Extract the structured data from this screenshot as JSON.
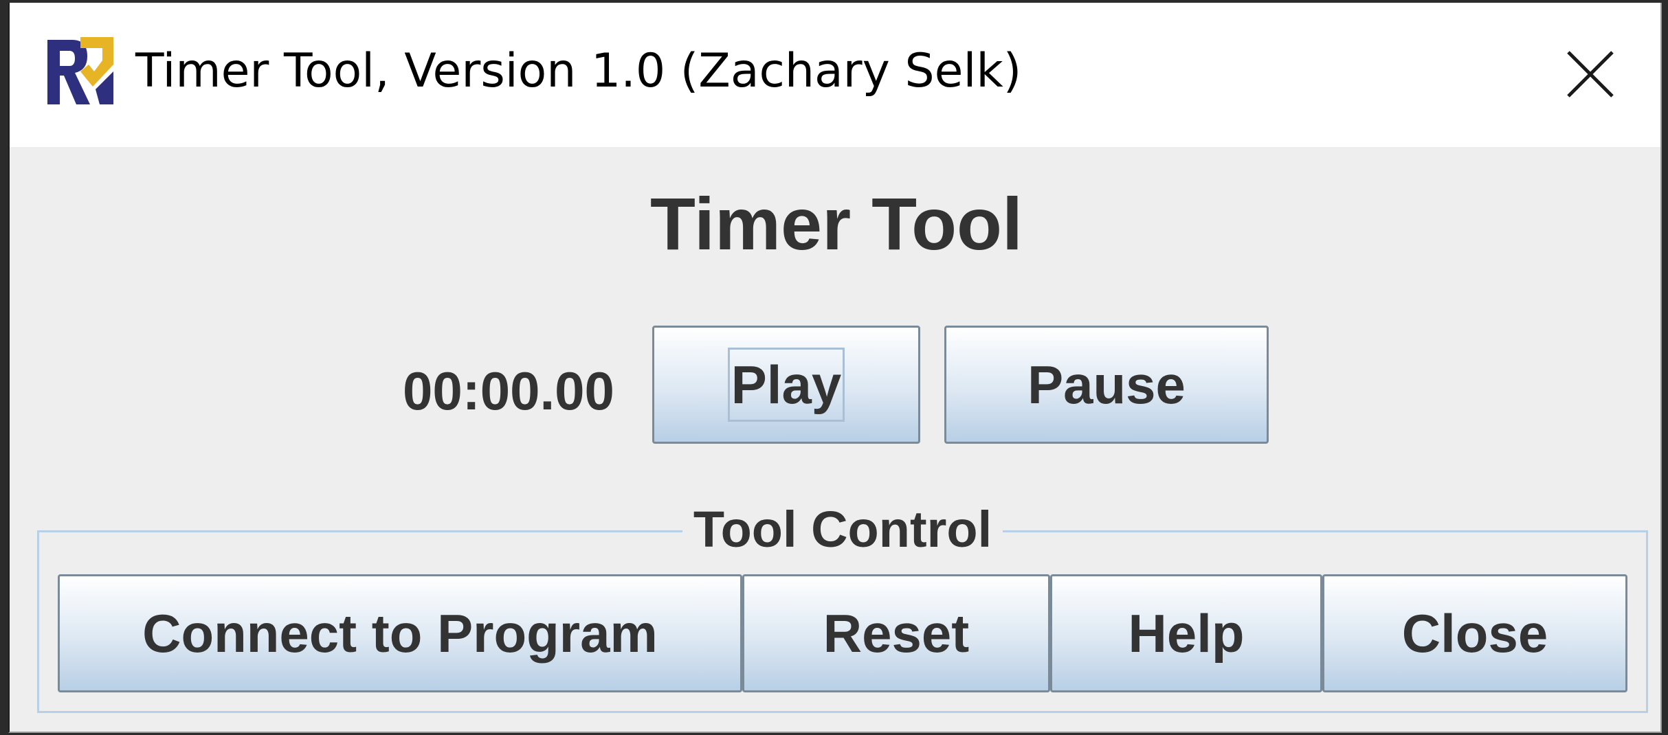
{
  "window": {
    "title": "Timer Tool, Version 1.0 (Zachary Selk)",
    "icon": "app-logo-icon",
    "close_icon": "close-icon"
  },
  "main": {
    "heading": "Timer Tool",
    "timer_value": "00:00.00",
    "play_label": "Play",
    "pause_label": "Pause"
  },
  "tool_control": {
    "title": "Tool Control",
    "buttons": [
      {
        "label": "Connect to Program"
      },
      {
        "label": "Reset"
      },
      {
        "label": "Help"
      },
      {
        "label": "Close"
      }
    ]
  },
  "colors": {
    "button_top": "#ffffff",
    "button_bottom": "#b8cfe5",
    "button_border": "#7a8a99",
    "group_border": "#b7d0e8",
    "panel_bg": "#eeeeee",
    "logo_navy": "#2e2f7f",
    "logo_gold": "#e6b424"
  }
}
